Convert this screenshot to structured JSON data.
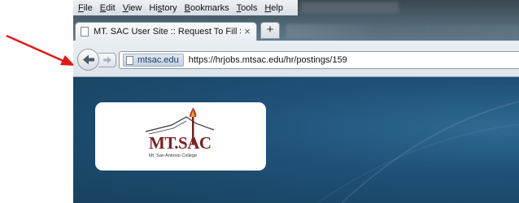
{
  "menu": {
    "items": [
      {
        "key": "F",
        "rest": "ile"
      },
      {
        "key": "E",
        "rest": "dit"
      },
      {
        "key": "V",
        "rest": "iew"
      },
      {
        "pre": "Hi",
        "key": "s",
        "rest": "tory"
      },
      {
        "key": "B",
        "rest": "ookmarks"
      },
      {
        "key": "T",
        "rest": "ools"
      },
      {
        "key": "H",
        "rest": "elp"
      }
    ]
  },
  "tab": {
    "label": "MT. SAC User Site :: Request To Fill Sho..."
  },
  "newtab": {
    "label": "+"
  },
  "urlbar": {
    "identity": "mtsac.edu",
    "url": "https://hrjobs.mtsac.edu/hr/postings/159"
  },
  "logo": {
    "name": "MT.SAC",
    "subtitle": "Mt. San Antonio College"
  },
  "colors": {
    "page_bg": "#1f5077",
    "annotation": "#e01818",
    "logo_maroon": "#7a1f1f"
  }
}
